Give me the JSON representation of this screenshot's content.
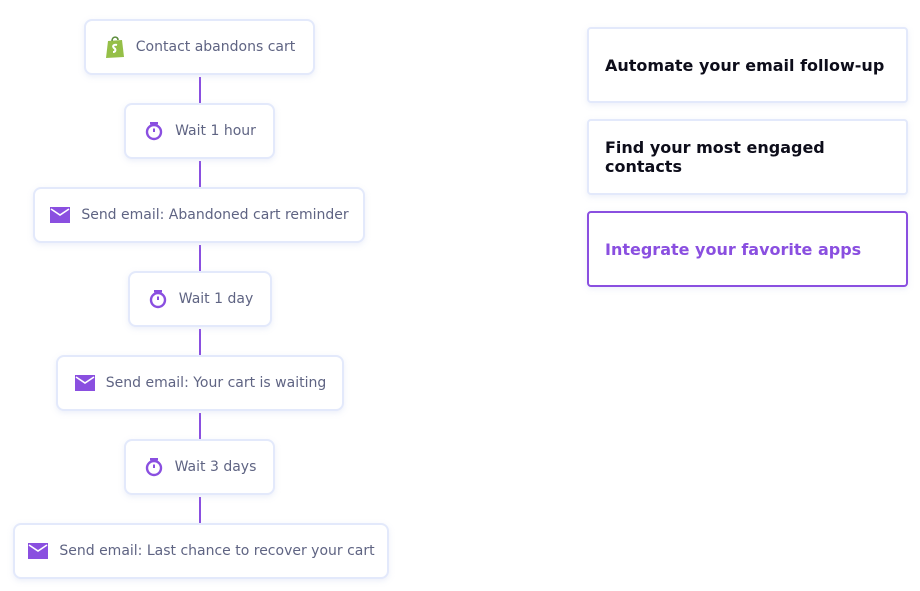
{
  "workflow": {
    "accent_color": "#8a4fe0",
    "steps": [
      {
        "type": "trigger",
        "icon": "shopify-icon",
        "label": "Contact abandons cart"
      },
      {
        "type": "wait",
        "icon": "stopwatch-icon",
        "label": "Wait 1 hour"
      },
      {
        "type": "email",
        "icon": "envelope-icon",
        "label": "Send email: Abandoned cart reminder"
      },
      {
        "type": "wait",
        "icon": "stopwatch-icon",
        "label": "Wait 1 day"
      },
      {
        "type": "email",
        "icon": "envelope-icon",
        "label": "Send email: Your cart is waiting"
      },
      {
        "type": "wait",
        "icon": "stopwatch-icon",
        "label": "Wait 3 days"
      },
      {
        "type": "email",
        "icon": "envelope-icon",
        "label": "Send email: Last chance to recover your cart"
      }
    ]
  },
  "features": {
    "items": [
      {
        "label": "Automate your email follow-up",
        "active": false
      },
      {
        "label": "Find your most engaged contacts",
        "active": false
      },
      {
        "label": "Integrate your favorite apps",
        "active": true
      }
    ]
  }
}
